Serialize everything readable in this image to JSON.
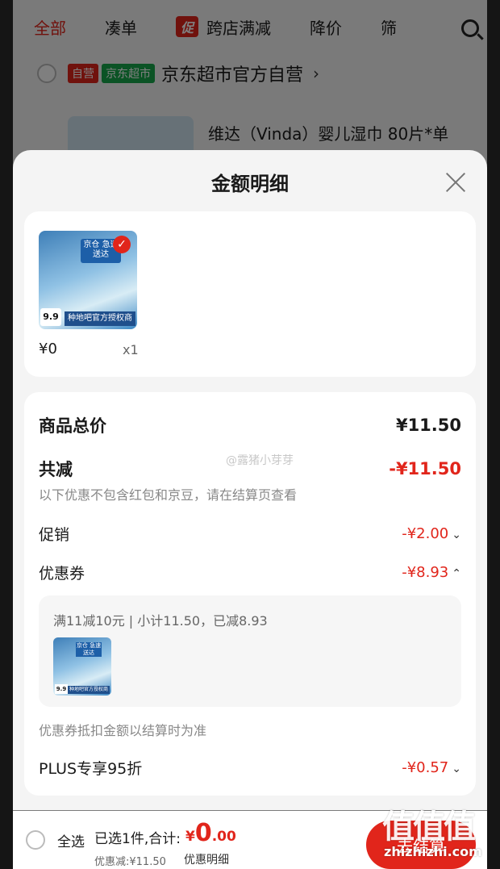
{
  "cart": {
    "tabs": [
      "全部",
      "凑单",
      "跨店满减",
      "降价",
      "筛"
    ],
    "promo_badge": "促",
    "shop_tag_self": "自营",
    "shop_tag_market": "京东超市",
    "shop_name": "京东超市官方自营",
    "product_title": "维达（Vinda）婴儿湿巾 80片*单"
  },
  "sheet": {
    "title": "金额明细",
    "item": {
      "price": "¥0",
      "qty": "x1",
      "image_label": "京仓 急速送达",
      "image_band": "种地吧官方授权商",
      "image_price": "9.9"
    },
    "total_label": "商品总价",
    "total_value": "¥11.50",
    "reduce_label": "共减",
    "reduce_value": "-¥11.50",
    "reduce_note": "以下优惠不包含红包和京豆，请在结算页查看",
    "watermark": "@露猪小芽芽",
    "promo_label": "促销",
    "promo_value": "-¥2.00",
    "coupon_label": "优惠券",
    "coupon_value": "-¥8.93",
    "coupon_detail": "满11减10元 | 小计11.50，已减8.93",
    "coupon_note": "优惠券抵扣金额以结算时为准",
    "plus_label": "PLUS专享95折",
    "plus_value": "-¥0.57"
  },
  "bottom": {
    "select_all": "全选",
    "selected": "已选1件,合计:",
    "total_symbol": "¥",
    "total_main": "0",
    "total_decimal": ".00",
    "discount": "优惠减:¥11.50",
    "detail": "优惠明细",
    "checkout": "去结算"
  },
  "watermark_logo": {
    "text": "值值值",
    "url": "zhizhizhi.com"
  }
}
